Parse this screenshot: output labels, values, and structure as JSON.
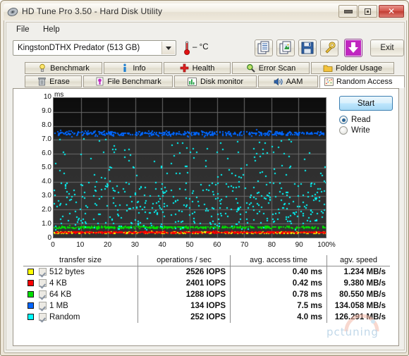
{
  "window": {
    "title": "HD Tune Pro 3.50 - Hard Disk Utility",
    "icon": "hard-disk-icon",
    "controls": {
      "minimize": "–",
      "maximize": "□",
      "close": "✕"
    }
  },
  "menu": {
    "file": "File",
    "help": "Help"
  },
  "toolbar": {
    "drive": "KingstonDTHX Predator (513 GB)",
    "temperature": "– °C",
    "exit_label": "Exit",
    "buttons": [
      {
        "name": "copy-text-icon",
        "title": "copy"
      },
      {
        "name": "copy-image-icon",
        "title": "copy image"
      },
      {
        "name": "save-icon",
        "title": "save"
      },
      {
        "name": "settings-icon",
        "title": "options"
      },
      {
        "name": "update-icon",
        "title": "check for updates"
      }
    ]
  },
  "tabs": {
    "row1": [
      {
        "label": "Benchmark",
        "icon": "lightbulb-icon",
        "active": false
      },
      {
        "label": "Info",
        "icon": "info-icon",
        "active": false
      },
      {
        "label": "Health",
        "icon": "red-cross-icon",
        "active": false
      },
      {
        "label": "Error Scan",
        "icon": "magnifier-icon",
        "active": false
      },
      {
        "label": "Folder Usage",
        "icon": "folder-icon",
        "active": false
      }
    ],
    "row2": [
      {
        "label": "Erase",
        "icon": "trash-icon",
        "active": false
      },
      {
        "label": "File Benchmark",
        "icon": "file-benchmark-icon",
        "active": false
      },
      {
        "label": "Disk monitor",
        "icon": "bar-chart-icon",
        "active": false
      },
      {
        "label": "AAM",
        "icon": "speaker-icon",
        "active": false
      },
      {
        "label": "Random Access",
        "icon": "scatter-icon",
        "active": true
      }
    ]
  },
  "controls": {
    "start_label": "Start",
    "read_label": "Read",
    "write_label": "Write",
    "mode_selected": "Read"
  },
  "results": {
    "headers": [
      "transfer size",
      "operations / sec",
      "avg. access time",
      "agv. speed"
    ],
    "rows": [
      {
        "color": "#ffff00",
        "checked": true,
        "size": "512 bytes",
        "iops": "2526 IOPS",
        "access": "0.40 ms",
        "speed": "1.234 MB/s"
      },
      {
        "color": "#ff0000",
        "checked": true,
        "size": "4 KB",
        "iops": "2401 IOPS",
        "access": "0.42 ms",
        "speed": "9.380 MB/s"
      },
      {
        "color": "#00e000",
        "checked": true,
        "size": "64 KB",
        "iops": "1288 IOPS",
        "access": "0.78 ms",
        "speed": "80.550 MB/s"
      },
      {
        "color": "#0066ff",
        "checked": true,
        "size": "1 MB",
        "iops": "134 IOPS",
        "access": "7.5 ms",
        "speed": "134.058 MB/s"
      },
      {
        "color": "#00ffff",
        "checked": true,
        "size": "Random",
        "iops": "252 IOPS",
        "access": "4.0 ms",
        "speed": "126.291 MB/s"
      }
    ]
  },
  "watermark": {
    "text": "pctuning"
  },
  "chart_data": {
    "type": "scatter",
    "title": "",
    "xlabel": "",
    "ylabel": "ms",
    "xlim": [
      0,
      100
    ],
    "ylim": [
      0,
      10
    ],
    "xticks": [
      "0",
      "10",
      "20",
      "30",
      "40",
      "50",
      "60",
      "70",
      "80",
      "90",
      "100%"
    ],
    "yticks": [
      "0",
      "1.0",
      "2.0",
      "3.0",
      "4.0",
      "5.0",
      "6.0",
      "7.0",
      "8.0",
      "9.0",
      "10"
    ],
    "grid": true,
    "background": "#111111",
    "gridcolor": "#6b6b6b",
    "legend_position": "table-below",
    "series": [
      {
        "name": "512 bytes",
        "color": "#ffff00",
        "mean_ms": 0.4,
        "spread_ms": 0.1,
        "points": 420
      },
      {
        "name": "4 KB",
        "color": "#ff0000",
        "mean_ms": 0.42,
        "spread_ms": 0.1,
        "points": 420
      },
      {
        "name": "64 KB",
        "color": "#00e000",
        "mean_ms": 0.78,
        "spread_ms": 0.14,
        "points": 400
      },
      {
        "name": "1 MB",
        "color": "#0066ff",
        "mean_ms": 7.5,
        "spread_ms": 0.3,
        "points": 420
      },
      {
        "name": "Random",
        "color": "#00ffff",
        "mean_ms": 4.0,
        "spread_ms": 2.6,
        "points": 520
      }
    ]
  }
}
